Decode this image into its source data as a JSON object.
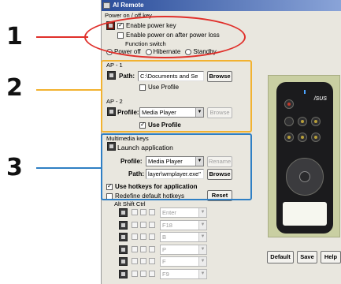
{
  "callouts": [
    {
      "number": "1",
      "color": "#e0302b"
    },
    {
      "number": "2",
      "color": "#f2b230"
    },
    {
      "number": "3",
      "color": "#2f7fc4"
    }
  ],
  "window": {
    "title": "AI Remote"
  },
  "power": {
    "group_label": "Power on / off key",
    "enable_power_key": "Enable power key",
    "enable_power_after_loss": "Enable power on after power loss",
    "function_switch_label": "Function switch",
    "options": [
      "Power off",
      "Hibernate",
      "Standby"
    ]
  },
  "ap1": {
    "group_label": "AP - 1",
    "path_label": "Path:",
    "path_value": "C:\\Documents and Se",
    "browse_label": "Browse",
    "use_profile_label": "Use Profile"
  },
  "ap2": {
    "group_label": "AP - 2",
    "profile_label": "Profile:",
    "profile_value": "Media Player",
    "browse_label": "Browse",
    "use_profile_label": "Use Profile"
  },
  "multimedia": {
    "group_label": "Multimedia keys",
    "launch_label": "Launch application",
    "profile_label": "Profile:",
    "profile_value": "Media Player",
    "rename_label": "Rename",
    "path_label": "Path:",
    "path_value": "layer\\wmplayer.exe\"",
    "browse_label": "Browse",
    "use_hotkeys_label": "Use hotkeys for application",
    "redefine_label": "Redefine default hotkeys",
    "reset_label": "Reset",
    "modifiers_label": "Alt Shift Ctrl"
  },
  "hotkeys": [
    {
      "icon": "play-icon",
      "key": "Enter"
    },
    {
      "icon": "stop-icon",
      "key": "F18"
    },
    {
      "icon": "prev-icon",
      "key": "B"
    },
    {
      "icon": "next-icon",
      "key": "P"
    },
    {
      "icon": "forward-icon",
      "key": "F"
    },
    {
      "icon": "volume-icon",
      "key": "F9"
    }
  ],
  "footer": {
    "default_label": "Default",
    "save_label": "Save",
    "help_label": "Help"
  },
  "remote": {
    "brand": "/SUS"
  }
}
